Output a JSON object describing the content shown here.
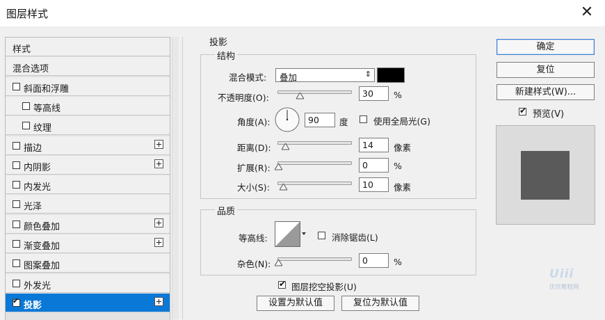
{
  "window": {
    "title": "图层样式",
    "close_glyph": "✕"
  },
  "style_list": {
    "items": [
      {
        "label": "样式",
        "checkbox": false,
        "checked": false,
        "plus": false,
        "indent": 0,
        "selected": false
      },
      {
        "label": "混合选项",
        "checkbox": false,
        "checked": false,
        "plus": false,
        "indent": 0,
        "selected": false
      },
      {
        "label": "斜面和浮雕",
        "checkbox": true,
        "checked": false,
        "plus": false,
        "indent": 0,
        "selected": false
      },
      {
        "label": "等高线",
        "checkbox": true,
        "checked": false,
        "plus": false,
        "indent": 1,
        "selected": false
      },
      {
        "label": "纹理",
        "checkbox": true,
        "checked": false,
        "plus": false,
        "indent": 1,
        "selected": false
      },
      {
        "label": "描边",
        "checkbox": true,
        "checked": false,
        "plus": true,
        "indent": 0,
        "selected": false
      },
      {
        "label": "内阴影",
        "checkbox": true,
        "checked": false,
        "plus": true,
        "indent": 0,
        "selected": false
      },
      {
        "label": "内发光",
        "checkbox": true,
        "checked": false,
        "plus": false,
        "indent": 0,
        "selected": false
      },
      {
        "label": "光泽",
        "checkbox": true,
        "checked": false,
        "plus": false,
        "indent": 0,
        "selected": false
      },
      {
        "label": "颜色叠加",
        "checkbox": true,
        "checked": false,
        "plus": true,
        "indent": 0,
        "selected": false
      },
      {
        "label": "渐变叠加",
        "checkbox": true,
        "checked": false,
        "plus": true,
        "indent": 0,
        "selected": false
      },
      {
        "label": "图案叠加",
        "checkbox": true,
        "checked": false,
        "plus": false,
        "indent": 0,
        "selected": false
      },
      {
        "label": "外发光",
        "checkbox": true,
        "checked": false,
        "plus": false,
        "indent": 0,
        "selected": false
      },
      {
        "label": "投影",
        "checkbox": true,
        "checked": true,
        "plus": true,
        "indent": 0,
        "selected": true
      }
    ]
  },
  "drop_shadow": {
    "section_title": "投影",
    "structure": {
      "title": "结构",
      "blend_mode_label": "混合模式:",
      "blend_mode_value": "叠加",
      "select_arrows": "⇕",
      "shadow_color": "#000000",
      "opacity_label": "不透明度(O):",
      "opacity_value": "30",
      "opacity_level": 0.3,
      "opacity_unit": "%",
      "angle_label": "角度(A):",
      "angle_value": "90",
      "angle_unit": "度",
      "global_light_label": "使用全局光(G)",
      "global_light_checked": false,
      "distance_label": "距离(D):",
      "distance_value": "14",
      "distance_unit": "像素",
      "spread_label": "扩展(R):",
      "spread_value": "0",
      "spread_unit": "%",
      "size_label": "大小(S):",
      "size_value": "10",
      "size_unit": "像素"
    },
    "quality": {
      "title": "品质",
      "contour_label": "等高线:",
      "anti_alias_label": "消除锯齿(L)",
      "anti_alias_checked": false,
      "noise_label": "杂色(N):",
      "noise_value": "0",
      "noise_unit": "%"
    },
    "knockout_label": "图层挖空投影(U)",
    "knockout_checked": true,
    "make_default_label": "设置为默认值",
    "reset_default_label": "复位为默认值"
  },
  "buttons": {
    "ok_label": "确定",
    "reset_label": "复位",
    "new_style_label": "新建样式(W)...",
    "preview_label": "预览(V)",
    "preview_checked": true
  },
  "preview": {
    "swatch_color": "#5a5a5a"
  },
  "watermark": {
    "text": "UiiiUiii",
    "subtext": "优优教程网"
  }
}
